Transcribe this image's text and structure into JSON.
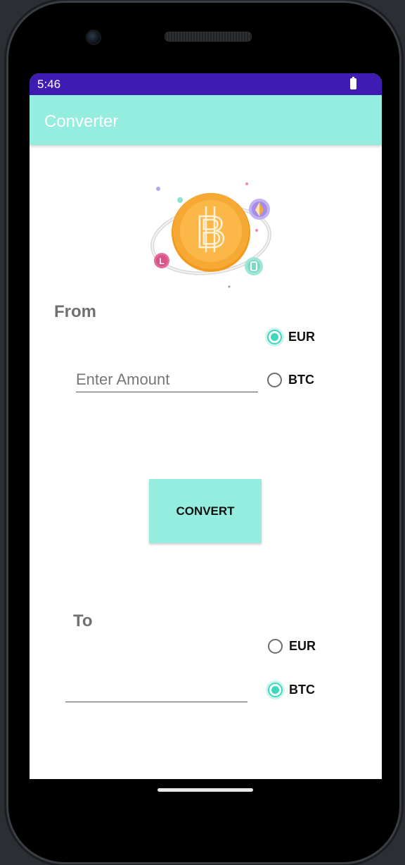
{
  "status_bar": {
    "time": "5:46"
  },
  "app_bar": {
    "title": "Converter"
  },
  "from_section": {
    "label": "From",
    "amount_placeholder": "Enter Amount",
    "amount_value": "",
    "options": [
      {
        "label": "EUR",
        "checked": true
      },
      {
        "label": "BTC",
        "checked": false
      }
    ]
  },
  "convert_button": {
    "label": "CONVERT"
  },
  "to_section": {
    "label": "To",
    "result_value": "",
    "options": [
      {
        "label": "EUR",
        "checked": false
      },
      {
        "label": "BTC",
        "checked": true
      }
    ]
  },
  "colors": {
    "status_bar": "#3f1bb3",
    "accent": "#94eddf",
    "radio_checked": "#3ed7bf",
    "coin": "#f7a935"
  },
  "icons": [
    "bitcoin-coin-icon",
    "ethereum-coin-icon",
    "litecoin-coin-icon",
    "crypto-coin-icon",
    "battery-icon"
  ]
}
